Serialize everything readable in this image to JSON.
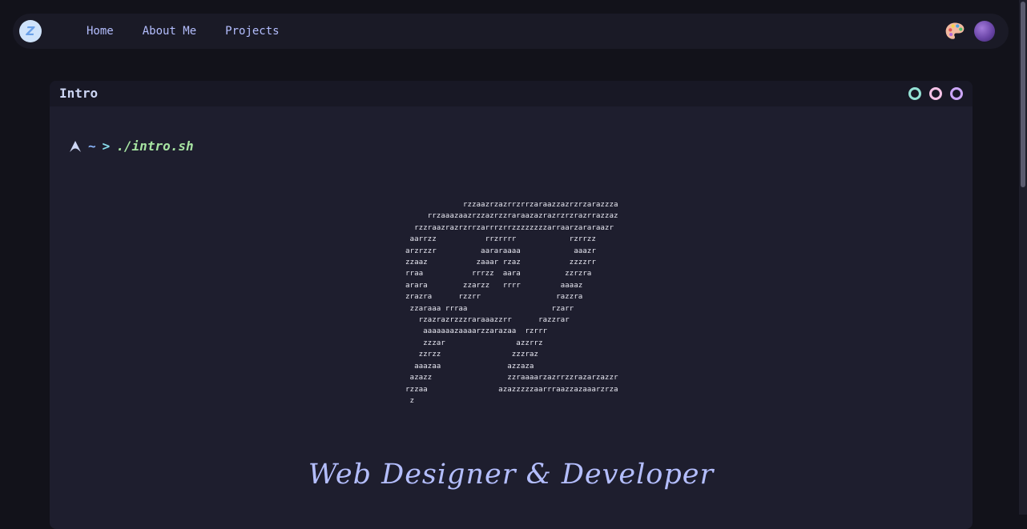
{
  "nav": {
    "logo_text": "Z",
    "links": [
      "Home",
      "About Me",
      "Projects"
    ],
    "palette_icon": "palette-icon",
    "avatar_icon": "avatar"
  },
  "window": {
    "title": "Intro",
    "dot_colors": [
      "#94e2d5",
      "#f5c2e7",
      "#cba6f7"
    ]
  },
  "prompt": {
    "icon": "arch-logo-icon",
    "path": "~",
    "arrow": ">",
    "command": "./intro.sh"
  },
  "ascii_art": "             rzzaazrzazrrzrrzaraazzazrzrzarazzza\n     rrzaaazaazrzzazrzzraraazazrazrzrzrazrrazzaz\n  rzzraazrazrzrrzarrrzrrzzzzzzzzarraarzararaazr\n aarrzz           rrzrrrr            rzrrzz\narzrzzr          aararaaaa            aaazr\nzzaaz           zaaar rzaz           zzzzrr\nrraa           rrrzz  aara          zzrzra\narara        zzarzz   rrrr         aaaaz\nzrazra      rzzrr                 razzra\n zzaraaa rrraa                   rzarr\n   rzazrazrzzzraraaazzrr      razzrar\n    aaaaaaazaaaarzzarazaa  rzrrr\n    zzzar                azzrrz\n   zzrzz                zzzraz\n  aaazaa               azzaza\n azazz                 zzraaaarzazrrzzrazarzazzr\nrzzaa                azazzzzzaarrraazzazaaarzrza\n z",
  "tagline": "Web Designer & Developer"
}
